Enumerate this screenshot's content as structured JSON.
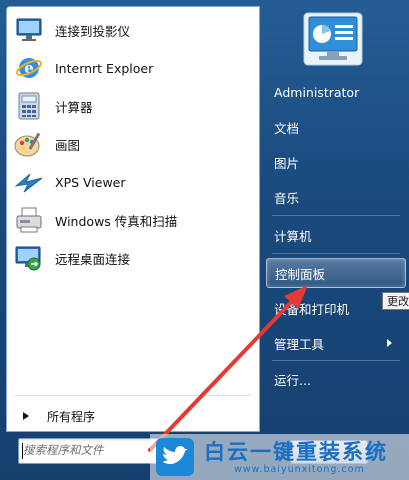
{
  "programs": [
    {
      "label": "连接到投影仪",
      "icon": "projector-monitor-icon"
    },
    {
      "label": "Internrt Exploer",
      "icon": "internet-explorer-icon"
    },
    {
      "label": "计算器",
      "icon": "calculator-icon"
    },
    {
      "label": "画图",
      "icon": "paint-palette-icon"
    },
    {
      "label": "XPS Viewer",
      "icon": "xps-viewer-icon"
    },
    {
      "label": "Windows 传真和扫描",
      "icon": "fax-scan-icon"
    },
    {
      "label": "远程桌面连接",
      "icon": "remote-desktop-icon"
    }
  ],
  "all_programs_label": "所有程序",
  "search": {
    "placeholder": "搜索程序和文件"
  },
  "right_menu": {
    "user": "Administrator",
    "documents": "文档",
    "pictures": "图片",
    "music": "音乐",
    "computer": "计算机",
    "control_panel": "控制面板",
    "devices_printers": "设备和打印机",
    "admin_tools": "管理工具",
    "run": "运行..."
  },
  "tooltip": "更改",
  "watermark": {
    "title": "白云一键重装系统",
    "url": "www.baiyunxitong.com"
  },
  "colors": {
    "menu_blue": "#1a4a7e",
    "highlight": "#ffffff",
    "arrow_red": "#e53935",
    "watermark_blue": "#1a6fc4"
  }
}
